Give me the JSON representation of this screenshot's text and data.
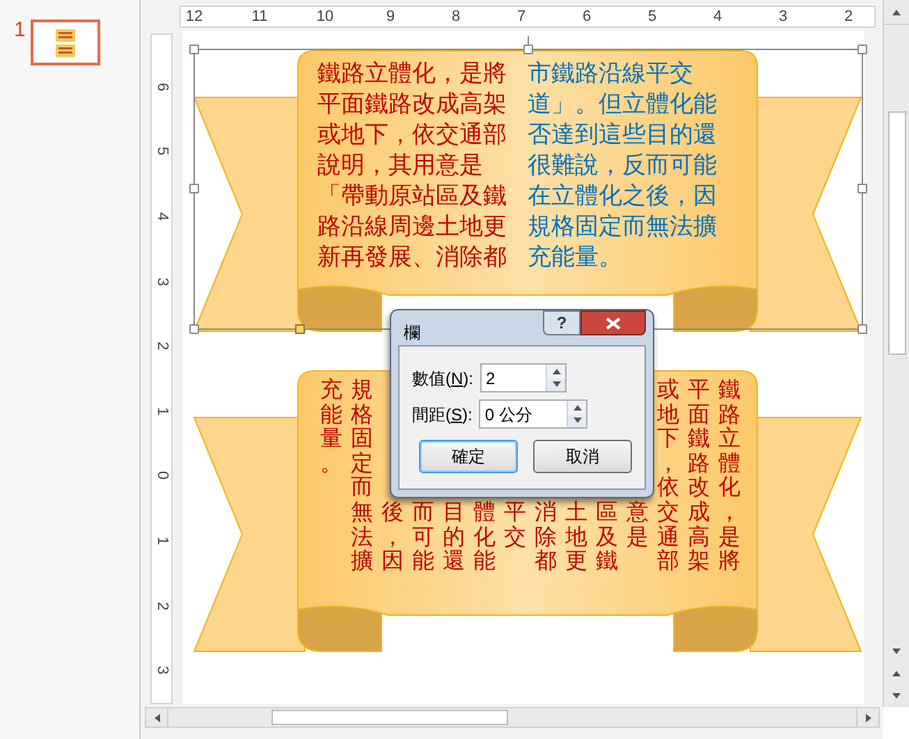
{
  "slide_panel": {
    "slide_number": "1",
    "selected": true
  },
  "ruler": {
    "horizontal": [
      "12",
      "11",
      "10",
      "9",
      "8",
      "7",
      "6",
      "5",
      "4",
      "3",
      "2"
    ],
    "vertical": [
      "6",
      "5",
      "4",
      "3",
      "2",
      "1",
      "0",
      "1",
      "2",
      "3"
    ]
  },
  "top_shape": {
    "selected": true,
    "columns": [
      {
        "color": "#c00000",
        "lines": [
          "鐵路立體化，是將",
          "平面鐵路改成高架",
          "或地下，依交通部",
          "說明，其用意是",
          "「帶動原站區及鐵",
          "路沿線周邊土地更",
          "新再發展、消除都"
        ]
      },
      {
        "color": "#0070c0",
        "lines": [
          "市鐵路沿線平交",
          "道」。但立體化能",
          "否達到這些目的還",
          "很難說，反而可能",
          "在立體化之後，因",
          "規格固定而無法擴",
          "充能量。"
        ]
      }
    ]
  },
  "bottom_shape": {
    "color": "#c00000",
    "columns": [
      {
        "text": "充能量。",
        "covered": false
      },
      {
        "text": "規格固定而無法擴",
        "covered": false
      },
      {
        "text": "後，因",
        "covered": true
      },
      {
        "text": "而可能",
        "covered": true
      },
      {
        "text": "目的還",
        "covered": true
      },
      {
        "text": "體化能",
        "covered": true
      },
      {
        "text": "平交",
        "covered": true
      },
      {
        "text": "消除都",
        "covered": true
      },
      {
        "text": "土地更",
        "covered": true
      },
      {
        "text": "區及鐵",
        "covered": true
      },
      {
        "text": "意是",
        "covered": true
      },
      {
        "text": "或地下，依交通部",
        "covered": false
      },
      {
        "text": "平面鐵路改成高架",
        "covered": false
      },
      {
        "text": "鐵路立體化，是將",
        "covered": false
      }
    ]
  },
  "dialog": {
    "title": "欄",
    "help": "?",
    "fields": [
      {
        "label_before": "數值(",
        "accesskey": "N",
        "label_after": "):",
        "value": "2"
      },
      {
        "label_before": "間距(",
        "accesskey": "S",
        "label_after": "):",
        "value": "0 公分"
      }
    ],
    "buttons": [
      {
        "label": "確定",
        "focused": true
      },
      {
        "label": "取消",
        "focused": false
      }
    ]
  }
}
